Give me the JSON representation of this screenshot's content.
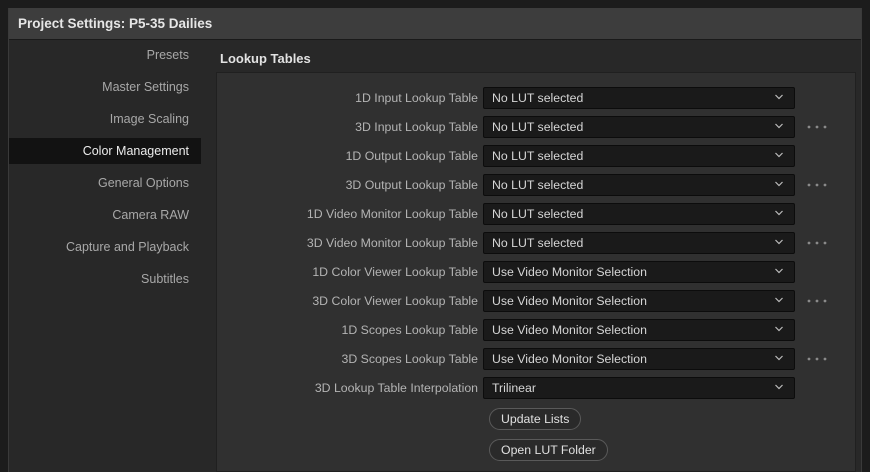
{
  "window": {
    "title": "Project Settings:  P5-35 Dailies"
  },
  "sidebar": {
    "items": [
      {
        "label": "Presets",
        "active": false
      },
      {
        "label": "Master Settings",
        "active": false
      },
      {
        "label": "Image Scaling",
        "active": false
      },
      {
        "label": "Color Management",
        "active": true
      },
      {
        "label": "General Options",
        "active": false
      },
      {
        "label": "Camera RAW",
        "active": false
      },
      {
        "label": "Capture and Playback",
        "active": false
      },
      {
        "label": "Subtitles",
        "active": false
      }
    ]
  },
  "main": {
    "section_title": "Lookup Tables",
    "rows": [
      {
        "label": "1D Input Lookup Table",
        "value": "No LUT selected",
        "has_more": false
      },
      {
        "label": "3D Input Lookup Table",
        "value": "No LUT selected",
        "has_more": true
      },
      {
        "label": "1D Output Lookup Table",
        "value": "No LUT selected",
        "has_more": false
      },
      {
        "label": "3D Output Lookup Table",
        "value": "No LUT selected",
        "has_more": true
      },
      {
        "label": "1D Video Monitor Lookup Table",
        "value": "No LUT selected",
        "has_more": false
      },
      {
        "label": "3D Video Monitor Lookup Table",
        "value": "No LUT selected",
        "has_more": true
      },
      {
        "label": "1D Color Viewer Lookup Table",
        "value": "Use Video Monitor Selection",
        "has_more": false
      },
      {
        "label": "3D Color Viewer Lookup Table",
        "value": "Use Video Monitor Selection",
        "has_more": true
      },
      {
        "label": "1D Scopes Lookup Table",
        "value": "Use Video Monitor Selection",
        "has_more": false
      },
      {
        "label": "3D Scopes Lookup Table",
        "value": "Use Video Monitor Selection",
        "has_more": true
      },
      {
        "label": "3D Lookup Table Interpolation",
        "value": "Trilinear",
        "has_more": false
      }
    ],
    "buttons": {
      "update_lists": "Update Lists",
      "open_lut_folder": "Open LUT Folder"
    }
  },
  "icons": {
    "dropdown": "chevron-down-icon",
    "more": "more-options-icon"
  },
  "colors": {
    "titlebar": "#3d3d3d",
    "background": "#282828",
    "panel": "#303030",
    "dropdown": "#1a1a1a",
    "active_item": "#121212"
  }
}
